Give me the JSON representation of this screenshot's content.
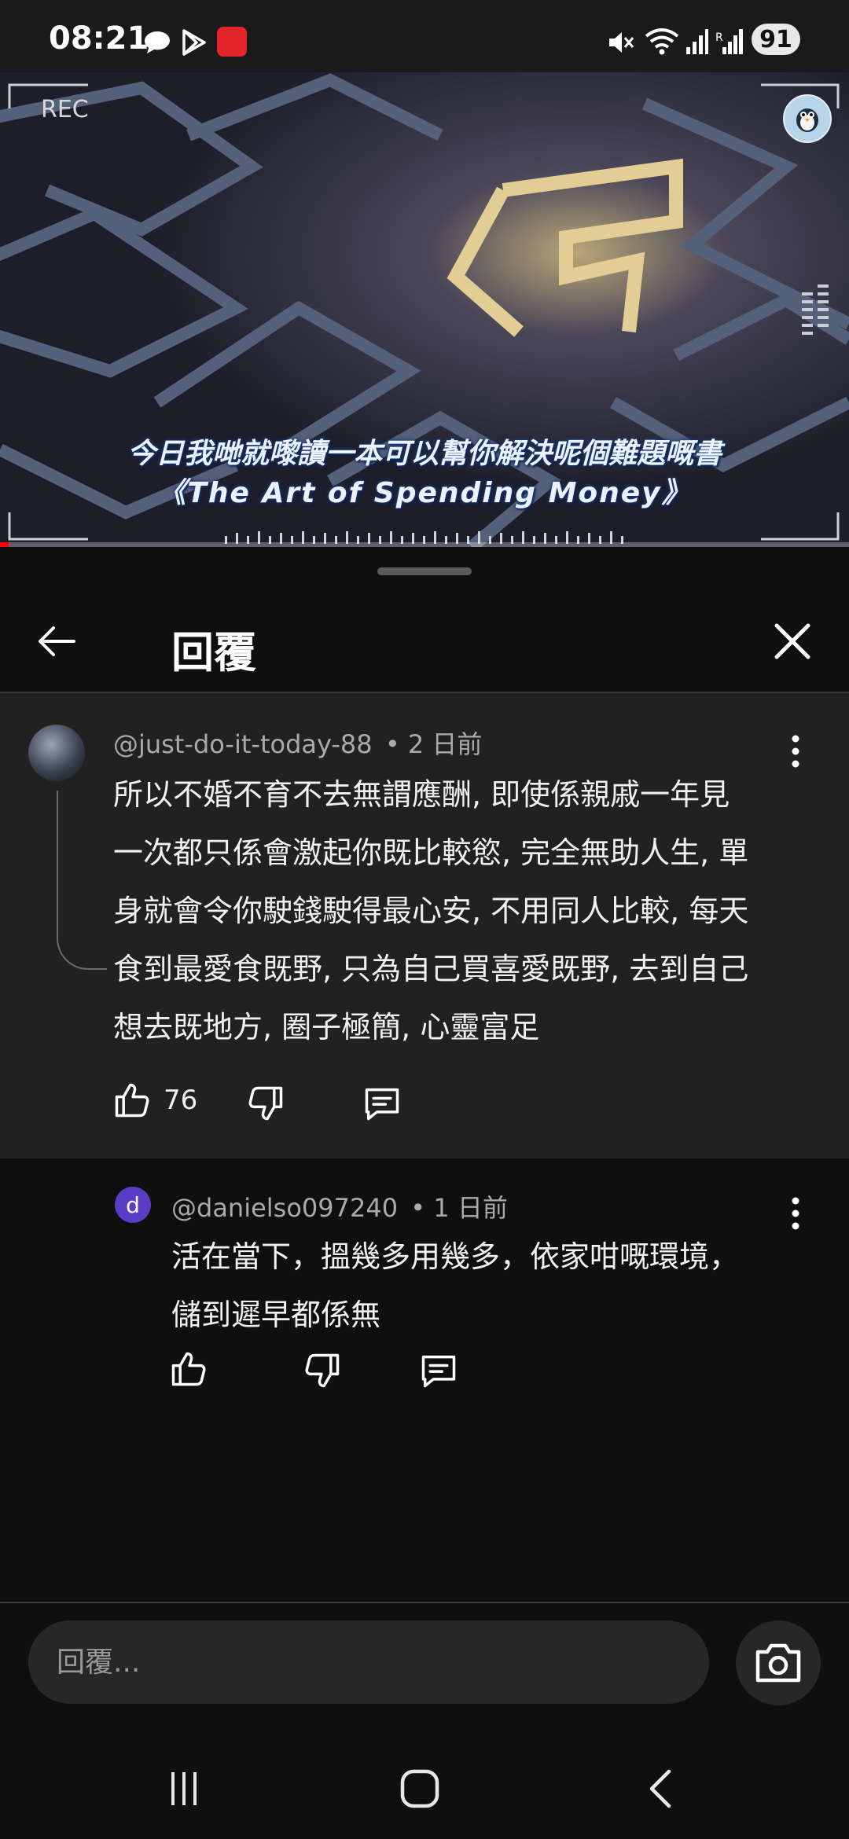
{
  "status_bar": {
    "time": "08:21",
    "battery": "91",
    "icons": [
      "chat-bubble-icon",
      "play-store-icon",
      "red-app-icon",
      "mute-icon",
      "wifi-icon",
      "signal-icon",
      "signal-r-icon"
    ]
  },
  "video": {
    "rec_label": "REC",
    "subtitle_line1": "今日我哋就嚟讀一本可以幫你解決呢個難題嘅書",
    "subtitle_line2": "《The Art of Spending Money》",
    "progress": 0.01
  },
  "sheet": {
    "title": "回覆",
    "back_icon": "arrow-left-icon",
    "close_icon": "close-icon"
  },
  "parent_comment": {
    "author": "@just-do-it-today-88",
    "time": "• 2 日前",
    "text_lines": [
      "所以不婚不育不去無謂應酬, 即使係親戚一年見",
      "一次都只係會激起你既比較慾, 完全無助人生, 單",
      "身就會令你駛錢駛得最心安, 不用同人比較, 每天",
      "食到最愛食既野, 只為自己買喜愛既野, 去到自己",
      "想去既地方, 圈子極簡, 心靈富足"
    ],
    "likes": "76"
  },
  "reply_comment": {
    "avatar_letter": "d",
    "author": "@danielso097240",
    "time": "• 1 日前",
    "text_lines": [
      "活在當下，搵幾多用幾多，依家咁嘅環境，",
      "儲到遲早都係無"
    ]
  },
  "reply_input": {
    "placeholder": "回覆..."
  },
  "colors": {
    "background": "#0f0f0f",
    "highlight_comment_bg": "#212121",
    "reply_avatar": "#5b3cc4",
    "progress_red": "#ff0000"
  }
}
